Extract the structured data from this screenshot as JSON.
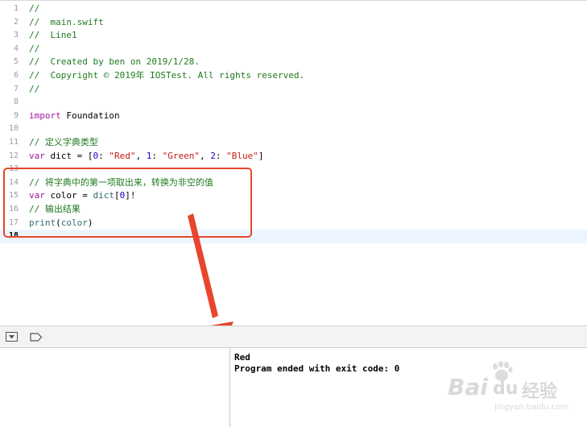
{
  "editor": {
    "lines": [
      {
        "num": "1",
        "tokens": [
          {
            "t": "//",
            "c": "comment"
          }
        ]
      },
      {
        "num": "2",
        "tokens": [
          {
            "t": "//  main.swift",
            "c": "comment"
          }
        ]
      },
      {
        "num": "3",
        "tokens": [
          {
            "t": "//  Line1",
            "c": "comment"
          }
        ]
      },
      {
        "num": "4",
        "tokens": [
          {
            "t": "//",
            "c": "comment"
          }
        ]
      },
      {
        "num": "5",
        "tokens": [
          {
            "t": "//  Created by ben on 2019/1/28.",
            "c": "comment"
          }
        ]
      },
      {
        "num": "6",
        "tokens": [
          {
            "t": "//  Copyright © 2019年 IOSTest. All rights reserved.",
            "c": "comment"
          }
        ]
      },
      {
        "num": "7",
        "tokens": [
          {
            "t": "//",
            "c": "comment"
          }
        ]
      },
      {
        "num": "8",
        "tokens": []
      },
      {
        "num": "9",
        "tokens": [
          {
            "t": "import",
            "c": "kw"
          },
          {
            "t": " Foundation",
            "c": "plain"
          }
        ]
      },
      {
        "num": "10",
        "tokens": []
      },
      {
        "num": "11",
        "tokens": [
          {
            "t": "// 定义字典类型",
            "c": "comment"
          }
        ]
      },
      {
        "num": "12",
        "tokens": [
          {
            "t": "var",
            "c": "kw"
          },
          {
            "t": " dict = [",
            "c": "plain"
          },
          {
            "t": "0",
            "c": "num"
          },
          {
            "t": ": ",
            "c": "plain"
          },
          {
            "t": "\"Red\"",
            "c": "str"
          },
          {
            "t": ", ",
            "c": "plain"
          },
          {
            "t": "1",
            "c": "num"
          },
          {
            "t": ": ",
            "c": "plain"
          },
          {
            "t": "\"Green\"",
            "c": "str"
          },
          {
            "t": ", ",
            "c": "plain"
          },
          {
            "t": "2",
            "c": "num"
          },
          {
            "t": ": ",
            "c": "plain"
          },
          {
            "t": "\"Blue\"",
            "c": "str"
          },
          {
            "t": "]",
            "c": "plain"
          }
        ]
      },
      {
        "num": "13",
        "tokens": []
      },
      {
        "num": "14",
        "tokens": [
          {
            "t": "// 将字典中的第一项取出来，转换为非空的值",
            "c": "comment"
          }
        ]
      },
      {
        "num": "15",
        "tokens": [
          {
            "t": "var",
            "c": "kw"
          },
          {
            "t": " color = ",
            "c": "plain"
          },
          {
            "t": "dict",
            "c": "id"
          },
          {
            "t": "[",
            "c": "plain"
          },
          {
            "t": "0",
            "c": "num"
          },
          {
            "t": "]!",
            "c": "plain"
          }
        ]
      },
      {
        "num": "16",
        "tokens": [
          {
            "t": "// 输出结果",
            "c": "comment"
          }
        ]
      },
      {
        "num": "17",
        "tokens": [
          {
            "t": "print",
            "c": "id"
          },
          {
            "t": "(",
            "c": "plain"
          },
          {
            "t": "color",
            "c": "id"
          },
          {
            "t": ")",
            "c": "plain"
          }
        ]
      },
      {
        "num": "18",
        "tokens": [],
        "current": true
      }
    ]
  },
  "console": {
    "output_lines": [
      "Red",
      "Program ended with exit code: 0"
    ]
  },
  "debug_bar": {
    "hide_icon": "triangle-down-in-box-icon",
    "breakpoint_icon": "breakpoint-tag-icon"
  },
  "watermark": {
    "brand": "Bai",
    "brand_suffix": "du",
    "cn": "经验",
    "sub": "jingyan.baidu.com"
  },
  "colors": {
    "annotation": "#e8452e",
    "comment": "#1f7a1f",
    "keyword": "#a3169e",
    "string": "#c41a16",
    "number": "#1c00cf",
    "identifier": "#326d74",
    "current_line": "#ecf5ff"
  }
}
